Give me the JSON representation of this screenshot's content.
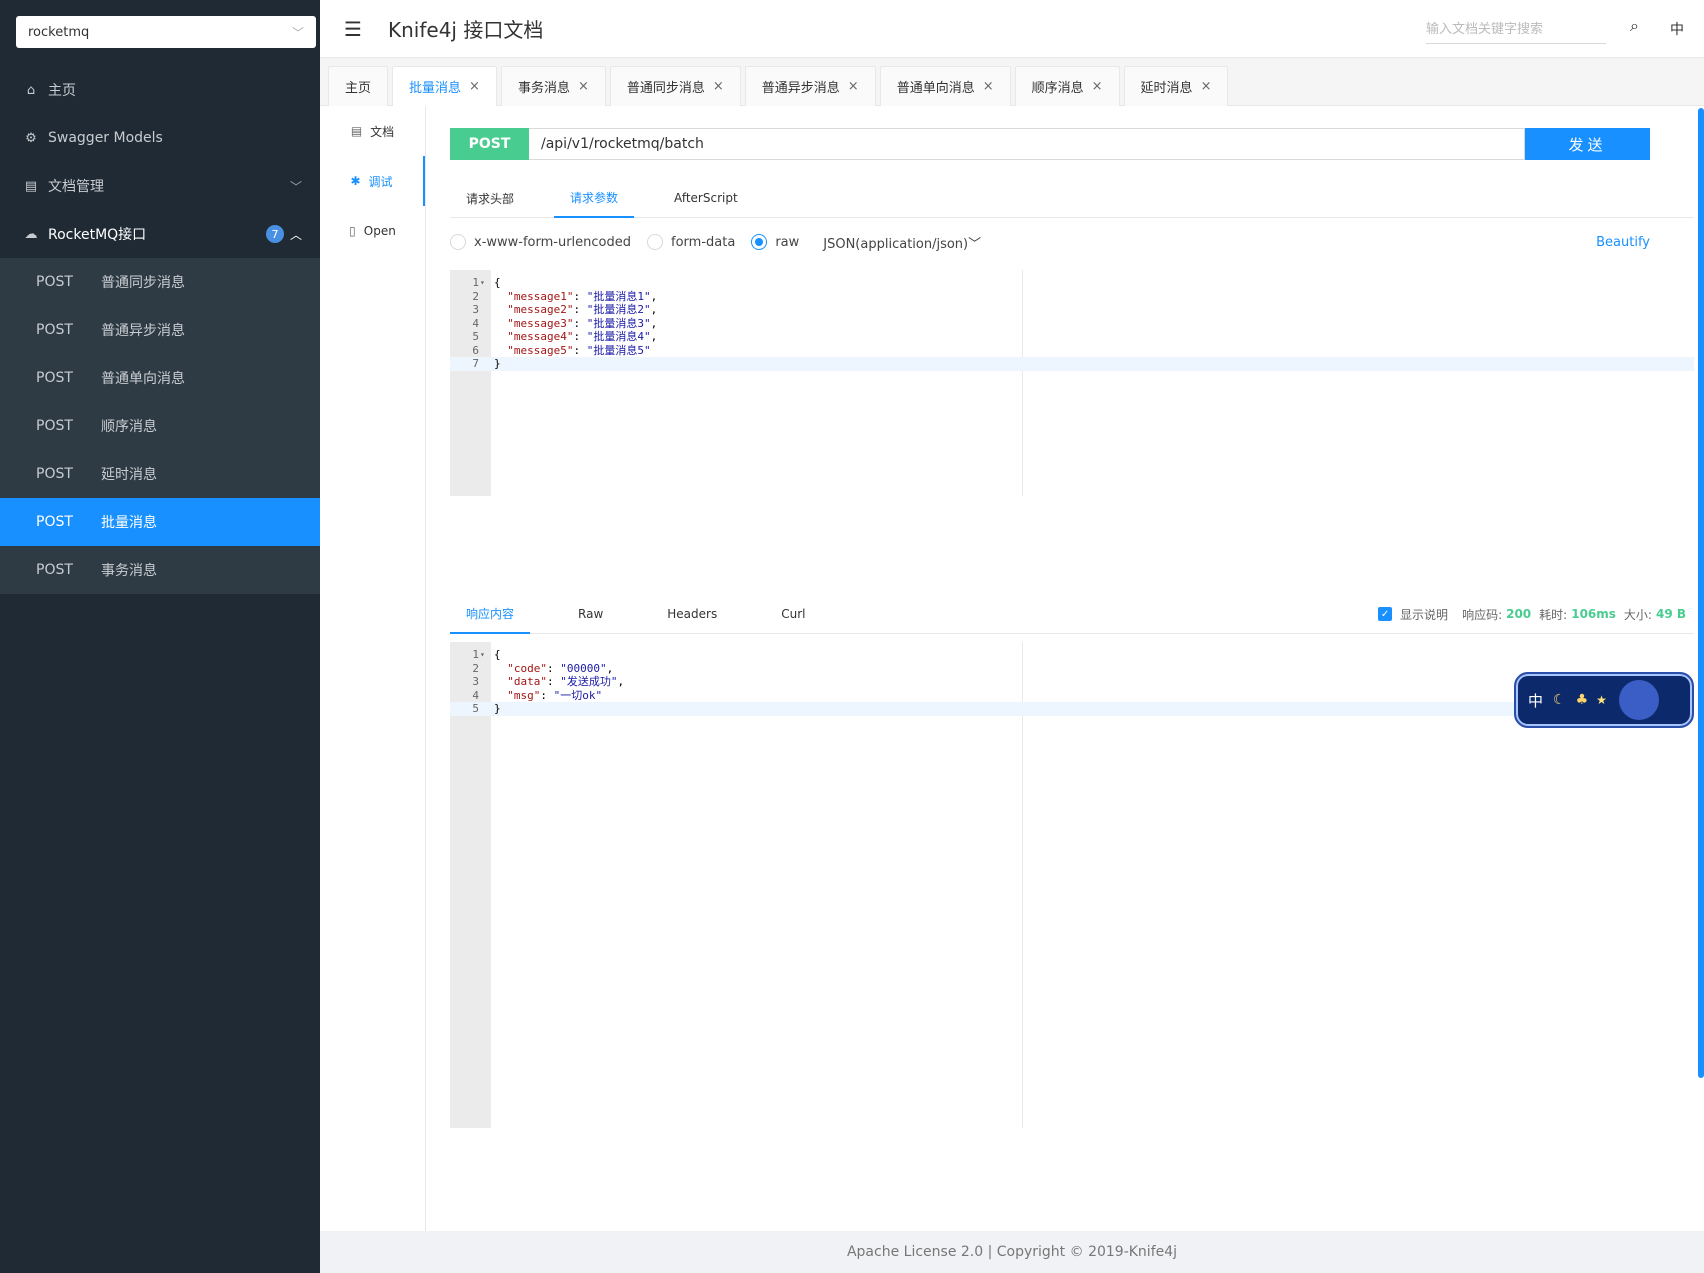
{
  "sidebar": {
    "group_select": "rocketmq",
    "menu": [
      {
        "label": "主页"
      },
      {
        "label": "Swagger Models"
      },
      {
        "label": "文档管理"
      }
    ],
    "group": {
      "label": "RocketMQ接口",
      "count": "7"
    },
    "items": [
      {
        "method": "POST",
        "label": "普通同步消息"
      },
      {
        "method": "POST",
        "label": "普通异步消息"
      },
      {
        "method": "POST",
        "label": "普通单向消息"
      },
      {
        "method": "POST",
        "label": "顺序消息"
      },
      {
        "method": "POST",
        "label": "延时消息"
      },
      {
        "method": "POST",
        "label": "批量消息",
        "active": true
      },
      {
        "method": "POST",
        "label": "事务消息"
      }
    ]
  },
  "header": {
    "title": "Knife4j 接口文档",
    "search_placeholder": "输入文档关键字搜索",
    "lang": "中"
  },
  "tabs": [
    {
      "label": "主页"
    },
    {
      "label": "批量消息",
      "active": true
    },
    {
      "label": "事务消息"
    },
    {
      "label": "普通同步消息"
    },
    {
      "label": "普通异步消息"
    },
    {
      "label": "普通单向消息"
    },
    {
      "label": "顺序消息"
    },
    {
      "label": "延时消息"
    }
  ],
  "side_tabs": [
    {
      "label": "文档",
      "icon": "document-icon"
    },
    {
      "label": "调试",
      "icon": "bug-icon",
      "active": true
    },
    {
      "label": "Open",
      "icon": "file-icon"
    }
  ],
  "request": {
    "method": "POST",
    "url": "/api/v1/rocketmq/batch",
    "send_label": "发送",
    "tabs": [
      "请求头部",
      "请求参数",
      "AfterScript"
    ],
    "body_types": [
      "x-www-form-urlencoded",
      "form-data",
      "raw"
    ],
    "content_type": "JSON(application/json)",
    "beautify": "Beautify",
    "body_lines": [
      {
        "n": "1",
        "text": "{"
      },
      {
        "n": "2",
        "key": "\"message1\"",
        "val": "\"批量消息1\"",
        "comma": ","
      },
      {
        "n": "3",
        "key": "\"message2\"",
        "val": "\"批量消息2\"",
        "comma": ","
      },
      {
        "n": "4",
        "key": "\"message3\"",
        "val": "\"批量消息3\"",
        "comma": ","
      },
      {
        "n": "5",
        "key": "\"message4\"",
        "val": "\"批量消息4\"",
        "comma": ","
      },
      {
        "n": "6",
        "key": "\"message5\"",
        "val": "\"批量消息5\"",
        "comma": ""
      },
      {
        "n": "7",
        "text": "}"
      }
    ]
  },
  "response": {
    "tabs": [
      "响应内容",
      "Raw",
      "Headers",
      "Curl"
    ],
    "show_desc": "显示说明",
    "status_label": "响应码:",
    "status": "200",
    "time_label": "耗时:",
    "time": "106ms",
    "size_label": "大小:",
    "size": "49 B",
    "body_lines": [
      {
        "n": "1",
        "text": "{"
      },
      {
        "n": "2",
        "key": "\"code\"",
        "val": "\"00000\"",
        "comma": ","
      },
      {
        "n": "3",
        "key": "\"data\"",
        "val": "\"发送成功\"",
        "comma": ","
      },
      {
        "n": "4",
        "key": "\"msg\"",
        "val": "\"一切ok\"",
        "comma": ""
      },
      {
        "n": "5",
        "text": "}"
      }
    ]
  },
  "widget": {
    "label": "中"
  },
  "footer": "Apache License 2.0 | Copyright © 2019-Knife4j",
  "colors": {
    "accent": "#1890ff",
    "sidebar": "#1f2a34",
    "post": "#49cc90"
  }
}
